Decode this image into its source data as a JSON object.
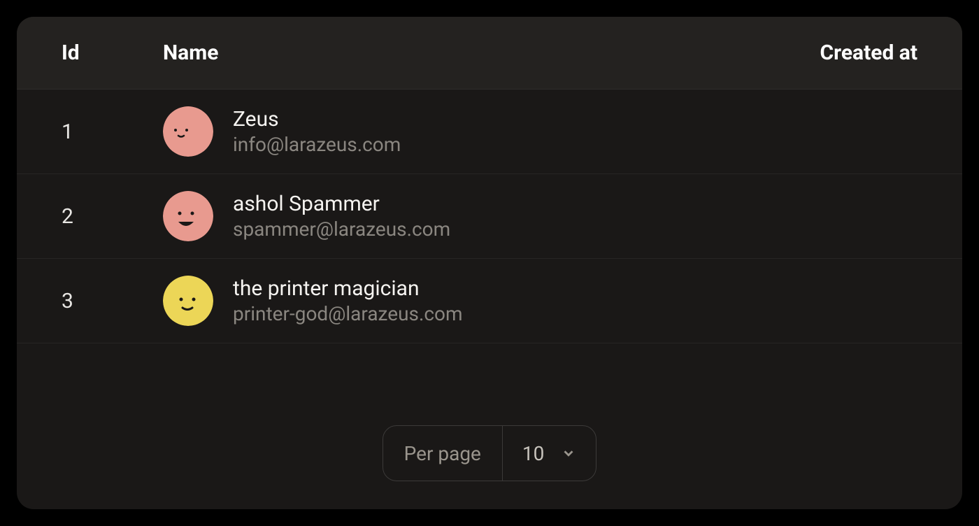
{
  "columns": {
    "id": "Id",
    "name": "Name",
    "created_at": "Created at"
  },
  "rows": [
    {
      "id": "1",
      "name": "Zeus",
      "email": "info@larazeus.com",
      "avatar_color": "#e89a8f",
      "avatar_face": "calm"
    },
    {
      "id": "2",
      "name": "ashol Spammer",
      "email": "spammer@larazeus.com",
      "avatar_color": "#e89a8f",
      "avatar_face": "laugh"
    },
    {
      "id": "3",
      "name": "the printer magician",
      "email": "printer-god@larazeus.com",
      "avatar_color": "#ecd657",
      "avatar_face": "smile"
    }
  ],
  "pagination": {
    "label": "Per page",
    "value": "10"
  }
}
